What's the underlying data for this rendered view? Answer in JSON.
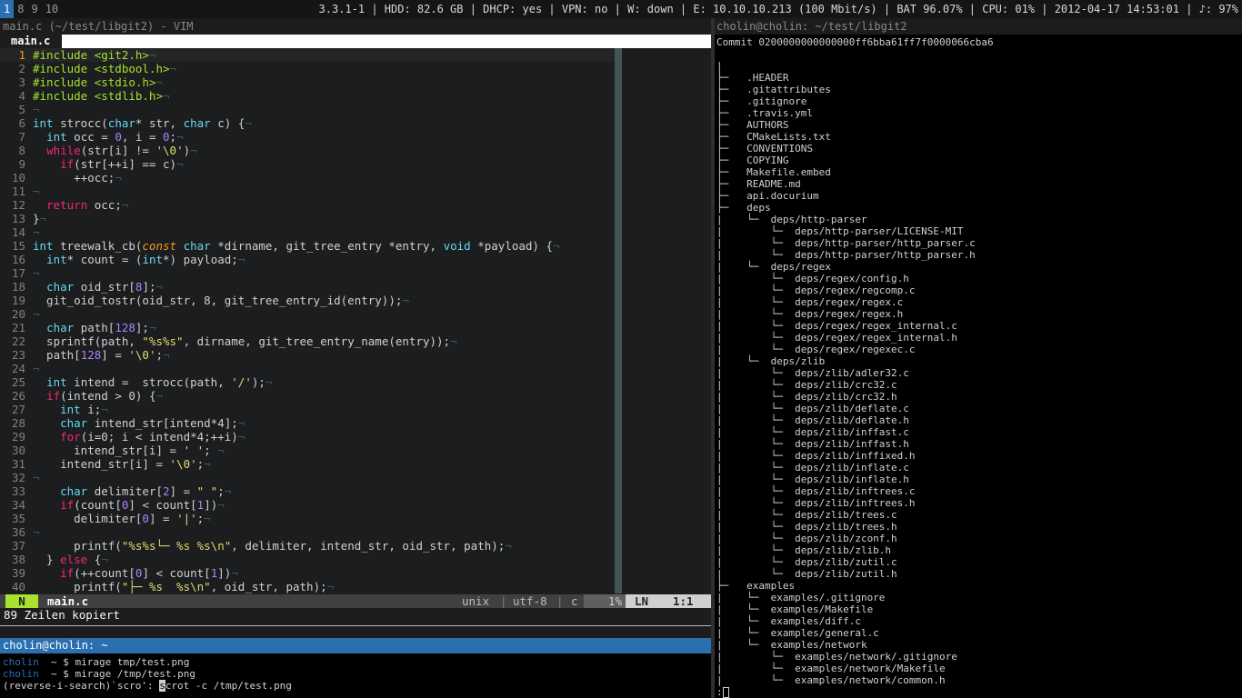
{
  "topbar": {
    "workspaces": [
      "1",
      "8",
      "9",
      "10"
    ],
    "status": "3.3.1-1 | HDD: 82.6 GB | DHCP: yes | VPN: no | W: down | E: 10.10.10.213 (100 Mbit/s) | BAT 96.07% | CPU: 01% | 2012-04-17 14:53:01 | ♪: 97%"
  },
  "vim": {
    "window_title": "main.c (~/test/libgit2) - VIM",
    "tab_label": "main.c",
    "lines": [
      {
        "n": "1",
        "t": "#include <git2.h>¬"
      },
      {
        "n": "2",
        "t": "#include <stdbool.h>¬"
      },
      {
        "n": "3",
        "t": "#include <stdio.h>¬"
      },
      {
        "n": "4",
        "t": "#include <stdlib.h>¬"
      },
      {
        "n": "5",
        "t": "¬"
      },
      {
        "n": "6",
        "t": "int strocc(char* str, char c) {¬"
      },
      {
        "n": "7",
        "t": "  int occ = 0, i = 0;¬"
      },
      {
        "n": "8",
        "t": "  while(str[i] != '\\0')¬"
      },
      {
        "n": "9",
        "t": "    if(str[++i] == c)¬"
      },
      {
        "n": "10",
        "t": "      ++occ;¬"
      },
      {
        "n": "11",
        "t": "¬"
      },
      {
        "n": "12",
        "t": "  return occ;¬"
      },
      {
        "n": "13",
        "t": "}¬"
      },
      {
        "n": "14",
        "t": "¬"
      },
      {
        "n": "15",
        "t": "int treewalk_cb(const char *dirname, git_tree_entry *entry, void *payload) {¬"
      },
      {
        "n": "16",
        "t": "  int* count = (int*) payload;¬"
      },
      {
        "n": "17",
        "t": "¬"
      },
      {
        "n": "18",
        "t": "  char oid_str[8];¬"
      },
      {
        "n": "19",
        "t": "  git_oid_tostr(oid_str, 8, git_tree_entry_id(entry));¬"
      },
      {
        "n": "20",
        "t": "¬"
      },
      {
        "n": "21",
        "t": "  char path[128];¬"
      },
      {
        "n": "22",
        "t": "  sprintf(path, \"%s%s\", dirname, git_tree_entry_name(entry));¬"
      },
      {
        "n": "23",
        "t": "  path[128] = '\\0';¬"
      },
      {
        "n": "24",
        "t": "¬"
      },
      {
        "n": "25",
        "t": "  int intend =  strocc(path, '/');¬"
      },
      {
        "n": "26",
        "t": "  if(intend > 0) {¬"
      },
      {
        "n": "27",
        "t": "    int i;¬"
      },
      {
        "n": "28",
        "t": "    char intend_str[intend*4];¬"
      },
      {
        "n": "29",
        "t": "    for(i=0; i < intend*4;++i)¬"
      },
      {
        "n": "30",
        "t": "      intend_str[i] = ' '; ¬"
      },
      {
        "n": "31",
        "t": "    intend_str[i] = '\\0';¬"
      },
      {
        "n": "32",
        "t": "¬"
      },
      {
        "n": "33",
        "t": "    char delimiter[2] = \" \";¬"
      },
      {
        "n": "34",
        "t": "    if(count[0] < count[1])¬"
      },
      {
        "n": "35",
        "t": "      delimiter[0] = '|';¬"
      },
      {
        "n": "36",
        "t": "¬"
      },
      {
        "n": "37",
        "t": "      printf(\"%s%s└─ %s %s\\n\", delimiter, intend_str, oid_str, path);¬"
      },
      {
        "n": "38",
        "t": "  } else {¬"
      },
      {
        "n": "39",
        "t": "    if(++count[0] < count[1])¬"
      },
      {
        "n": "40",
        "t": "      printf(\"├─ %s  %s\\n\", oid_str, path);¬"
      }
    ],
    "statusline": {
      "mode": "N",
      "filename": "main.c",
      "fileformat": "unix",
      "encoding": "utf-8",
      "filetype": "c",
      "percent": "1%",
      "ln_label": "LN",
      "position": "1:1"
    },
    "message": "89 Zeilen kopiert"
  },
  "shell": {
    "title": "cholin@cholin: ~",
    "lines": [
      {
        "host": "cholin",
        "prompt": "  ~ $ ",
        "cmd": "mirage tmp/test.png"
      },
      {
        "host": "cholin",
        "prompt": "  ~ $ ",
        "cmd": "mirage /tmp/test.png"
      }
    ],
    "search_prefix": "(reverse-i-search)`scro': ",
    "search_cursor_char": "s",
    "search_rest": "crot -c /tmp/test.png"
  },
  "tree_terminal": {
    "title": "cholin@cholin: ~/test/libgit2",
    "commit_line": "Commit 0200000000000000ff6bba61ff7f0000066cba6",
    "lines": [
      "|",
      "├─   .HEADER",
      "├─   .gitattributes",
      "├─   .gitignore",
      "├─   .travis.yml",
      "├─   AUTHORS",
      "├─   CMakeLists.txt",
      "├─   CONVENTIONS",
      "├─   COPYING",
      "├─   Makefile.embed",
      "├─   README.md",
      "├─   api.docurium",
      "├─   deps",
      "|    └─  deps/http-parser",
      "|        └─  deps/http-parser/LICENSE-MIT",
      "|        └─  deps/http-parser/http_parser.c",
      "|        └─  deps/http-parser/http_parser.h",
      "|    └─  deps/regex",
      "|        └─  deps/regex/config.h",
      "|        └─  deps/regex/regcomp.c",
      "|        └─  deps/regex/regex.c",
      "|        └─  deps/regex/regex.h",
      "|        └─  deps/regex/regex_internal.c",
      "|        └─  deps/regex/regex_internal.h",
      "|        └─  deps/regex/regexec.c",
      "|    └─  deps/zlib",
      "|        └─  deps/zlib/adler32.c",
      "|        └─  deps/zlib/crc32.c",
      "|        └─  deps/zlib/crc32.h",
      "|        └─  deps/zlib/deflate.c",
      "|        └─  deps/zlib/deflate.h",
      "|        └─  deps/zlib/inffast.c",
      "|        └─  deps/zlib/inffast.h",
      "|        └─  deps/zlib/inffixed.h",
      "|        └─  deps/zlib/inflate.c",
      "|        └─  deps/zlib/inflate.h",
      "|        └─  deps/zlib/inftrees.c",
      "|        └─  deps/zlib/inftrees.h",
      "|        └─  deps/zlib/trees.c",
      "|        └─  deps/zlib/trees.h",
      "|        └─  deps/zlib/zconf.h",
      "|        └─  deps/zlib/zlib.h",
      "|        └─  deps/zlib/zutil.c",
      "|        └─  deps/zlib/zutil.h",
      "├─   examples",
      "|    └─  examples/.gitignore",
      "|    └─  examples/Makefile",
      "|    └─  examples/diff.c",
      "|    └─  examples/general.c",
      "|    └─  examples/network",
      "|        └─  examples/network/.gitignore",
      "|        └─  examples/network/Makefile",
      "|        └─  examples/network/common.h"
    ],
    "prompt": ":"
  }
}
